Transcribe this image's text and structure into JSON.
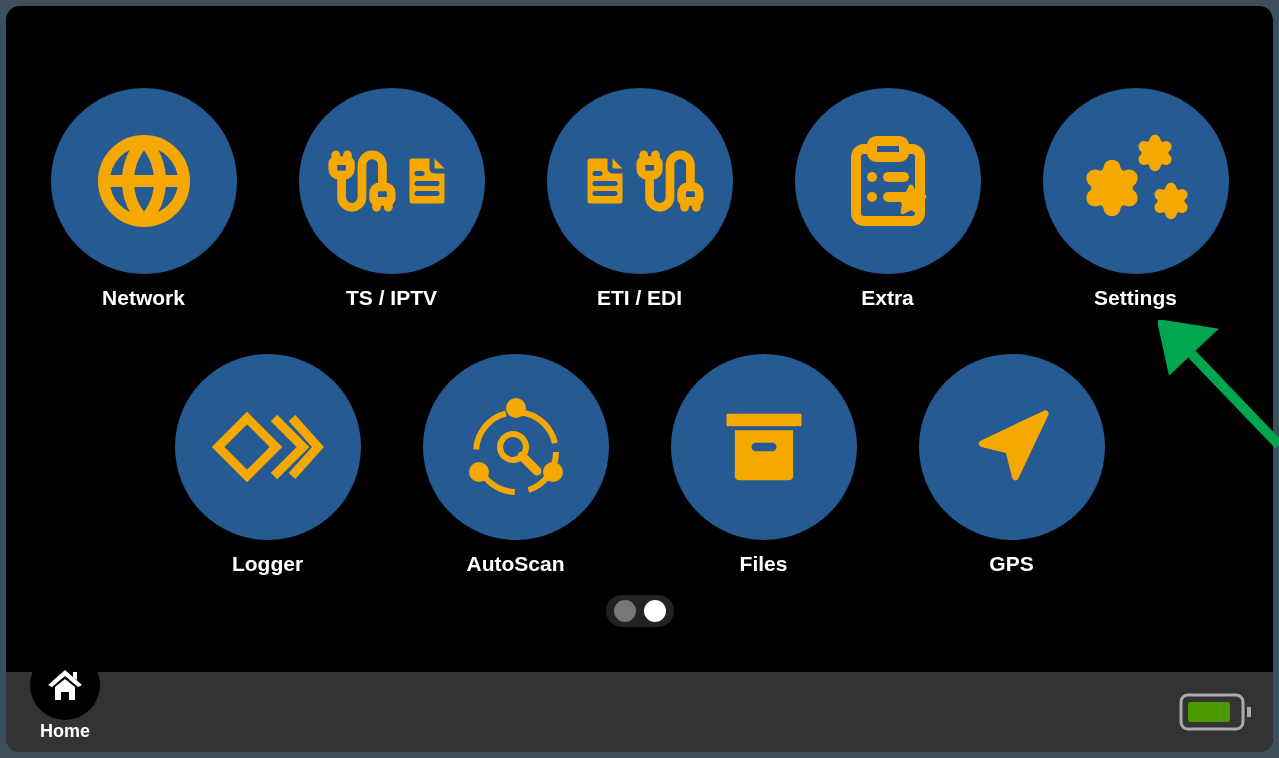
{
  "apps": [
    {
      "label": "Network",
      "kind": "globe"
    },
    {
      "label": "TS / IPTV",
      "kind": "cable-document"
    },
    {
      "label": "ETI / EDI",
      "kind": "document-cable"
    },
    {
      "label": "Extra",
      "kind": "clipboard-star"
    },
    {
      "label": "Settings",
      "kind": "gears"
    },
    {
      "label": "Logger",
      "kind": "chevrons"
    },
    {
      "label": "AutoScan",
      "kind": "scan"
    },
    {
      "label": "Files",
      "kind": "drawer"
    },
    {
      "label": "GPS",
      "kind": "navigation"
    }
  ],
  "pages": [
    {
      "selected": false
    },
    {
      "selected": true
    }
  ],
  "home": {
    "label": "Home"
  }
}
